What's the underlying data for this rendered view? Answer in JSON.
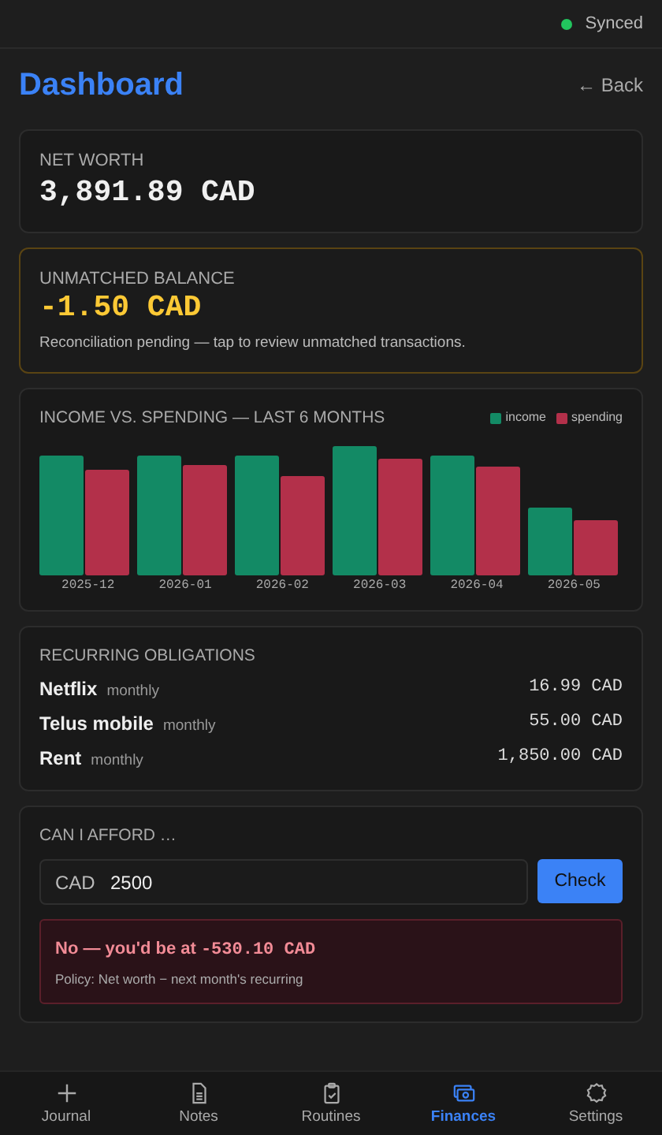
{
  "status": {
    "label": "Synced",
    "color": "#22c55e"
  },
  "header": {
    "title": "Dashboard",
    "back": "← Back"
  },
  "net_worth": {
    "label": "NET WORTH",
    "value": "3,891.89 CAD"
  },
  "unmatched": {
    "label": "UNMATCHED BALANCE",
    "value": "-1.50 CAD",
    "note": "Reconciliation pending — tap to review unmatched transactions."
  },
  "chart": {
    "title": "INCOME VS. SPENDING — LAST 6 MONTHS",
    "legend": [
      {
        "label": "income",
        "color": "#138a65"
      },
      {
        "label": "spending",
        "color": "#b3304a"
      }
    ],
    "categories": [
      "2025-12",
      "2026-01",
      "2026-02",
      "2026-03",
      "2026-04",
      "2026-05"
    ]
  },
  "recurring": {
    "title": "RECURRING OBLIGATIONS",
    "items": [
      {
        "name": "Netflix",
        "period": "monthly",
        "amount": "16.99 CAD"
      },
      {
        "name": "Telus mobile",
        "period": "monthly",
        "amount": "55.00 CAD"
      },
      {
        "name": "Rent",
        "period": "monthly",
        "amount": "1,850.00 CAD"
      }
    ]
  },
  "afford": {
    "title": "CAN I AFFORD …",
    "currency": "CAD",
    "value": "2500",
    "button": "Check",
    "result": {
      "headline": "No — you'd be at **-530.10 CAD**",
      "policy": "Policy: Net worth − next month's recurring"
    }
  },
  "nav": [
    {
      "kind": "plus",
      "label": "Journal",
      "selected": false
    },
    {
      "kind": "doc",
      "label": "Notes",
      "selected": false
    },
    {
      "kind": "clipboard",
      "label": "Routines",
      "selected": false
    },
    {
      "kind": "money",
      "label": "Finances",
      "selected": true
    },
    {
      "kind": "gear",
      "label": "Settings",
      "selected": false
    }
  ]
}
